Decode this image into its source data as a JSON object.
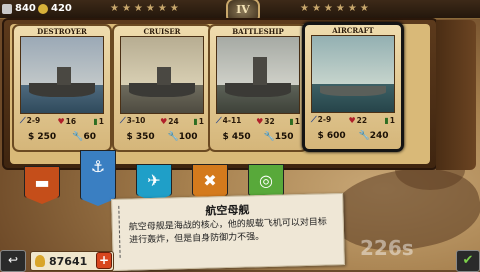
{
  "topbar": {
    "silver": "840",
    "medals": "420",
    "rank": "IV"
  },
  "cards": [
    {
      "name": "DESTROYER",
      "stats": [
        "2-9",
        "16",
        "1"
      ],
      "cost": "250",
      "upkeep": "60"
    },
    {
      "name": "CRUISER",
      "stats": [
        "3-10",
        "24",
        "1"
      ],
      "cost": "350",
      "upkeep": "100"
    },
    {
      "name": "BATTLESHIP",
      "stats": [
        "4-11",
        "32",
        "1"
      ],
      "cost": "450",
      "upkeep": "150"
    },
    {
      "name": "AIRCRAFT CARRIERS",
      "stats": [
        "2-9",
        "22",
        "1"
      ],
      "cost": "600",
      "upkeep": "240"
    }
  ],
  "tabs": [
    "tank-icon",
    "anchor-icon",
    "plane-icon",
    "wrench-icon",
    "target-icon"
  ],
  "description": {
    "title": "航空母舰",
    "text": "航空母舰是海战的核心，他的舰载飞机可以对目标进行轰炸，但是自身防御力不强。"
  },
  "bottom": {
    "gold": "87641",
    "plus": "+"
  },
  "watermark": "226s"
}
